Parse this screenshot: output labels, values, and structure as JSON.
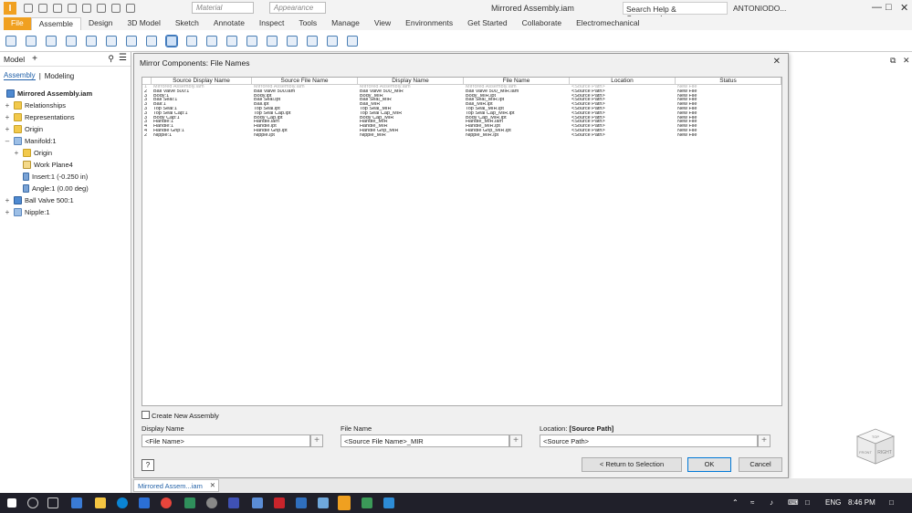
{
  "app": {
    "logo": "I",
    "title": "Mirrored Assembly.iam",
    "material": "Material",
    "appearance": "Appearance",
    "search_help": "Search Help & Commands...",
    "user": "ANTONIODO...",
    "colors": {
      "accent": "#f0a020",
      "link": "#1f5fa8",
      "taskbar": "#20202a"
    }
  },
  "ribbon_tabs": [
    "File",
    "Assemble",
    "Design",
    "3D Model",
    "Sketch",
    "Annotate",
    "Inspect",
    "Tools",
    "Manage",
    "View",
    "Environments",
    "Get Started",
    "Collaborate",
    "Electromechanical"
  ],
  "model_browser": {
    "title": "Model",
    "tabs": [
      "Assembly",
      "Modeling"
    ],
    "root": "Mirrored Assembly.iam",
    "nodes": [
      {
        "label": "Relationships",
        "icon": "folder-icon"
      },
      {
        "label": "Representations",
        "icon": "folder-icon"
      },
      {
        "label": "Origin",
        "icon": "folder-icon"
      },
      {
        "label": "Manifold:1",
        "icon": "part-icon"
      },
      {
        "label": "Origin",
        "icon": "folder-icon"
      },
      {
        "label": "Work Plane4",
        "icon": "workplane-icon"
      },
      {
        "label": "Insert:1 (-0.250 in)",
        "icon": "constraint-icon"
      },
      {
        "label": "Angle:1 (0.00 deg)",
        "icon": "constraint-icon"
      },
      {
        "label": "Ball Valve 500:1",
        "icon": "assembly-icon"
      },
      {
        "label": "Nipple:1",
        "icon": "part-icon"
      }
    ]
  },
  "dialog": {
    "title": "Mirror Components: File Names",
    "columns": [
      "Source Display Name",
      "Source File Name",
      "Display Name",
      "File Name",
      "Location",
      "Status"
    ],
    "rows": [
      {
        "n": "1",
        "src_display": "Mirrored Assembly.iam",
        "src_file": "Mirrored Assembly.iam",
        "display": "Mirrored Assembly.iam",
        "file": "Mirrored Assembly.iam",
        "location": "<Source Path>",
        "status": "New File"
      },
      {
        "n": "2",
        "src_display": "Ball Valve 500:1",
        "src_file": "Ball Valve 500.iam",
        "display": "Ball Valve 500_MIR",
        "file": "Ball Valve 500_MIR.iam",
        "location": "<Source Path>",
        "status": "New File"
      },
      {
        "n": "3",
        "src_display": "Body:1",
        "src_file": "Body.ipt",
        "display": "Body_MIR",
        "file": "Body_MIR.ipt",
        "location": "<Source Path>",
        "status": "New File"
      },
      {
        "n": "3",
        "src_display": "Ball Seal:1",
        "src_file": "Ball Seal.ipt",
        "display": "Ball Seal_MIR",
        "file": "Ball Seal_MIR.ipt",
        "location": "<Source Path>",
        "status": "New File"
      },
      {
        "n": "3",
        "src_display": "Ball:1",
        "src_file": "Ball.ipt",
        "display": "Ball_MIR",
        "file": "Ball_MIR.ipt",
        "location": "<Source Path>",
        "status": "New File"
      },
      {
        "n": "3",
        "src_display": "Top Seal:1",
        "src_file": "Top Seal.ipt",
        "display": "Top Seal_MIR",
        "file": "Top Seal_MIR.ipt",
        "location": "<Source Path>",
        "status": "New File"
      },
      {
        "n": "3",
        "src_display": "Top Seal Cap:1",
        "src_file": "Top Seal Cap.ipt",
        "display": "Top Seal Cap_MIR",
        "file": "Top Seal Cap_MIR.ipt",
        "location": "<Source Path>",
        "status": "New File"
      },
      {
        "n": "3",
        "src_display": "Body Cap:1",
        "src_file": "Body Cap.ipt",
        "display": "Body Cap_MIR",
        "file": "Body Cap_MIR.ipt",
        "location": "<Source Path>",
        "status": "New File"
      },
      {
        "n": "3",
        "src_display": "Handle:1",
        "src_file": "Handle.iam",
        "display": "Handle_MIR",
        "file": "Handle_MIR.iam",
        "location": "<Source Path>",
        "status": "New File"
      },
      {
        "n": "4",
        "src_display": "Handle:1",
        "src_file": "Handle.ipt",
        "display": "Handle_MIR",
        "file": "Handle_MIR.ipt",
        "location": "<Source Path>",
        "status": "New File"
      },
      {
        "n": "4",
        "src_display": "Handle Grip:1",
        "src_file": "Handle Grip.ipt",
        "display": "Handle Grip_MIR",
        "file": "Handle Grip_MIR.ipt",
        "location": "<Source Path>",
        "status": "New File"
      },
      {
        "n": "2",
        "src_display": "Nipple:1",
        "src_file": "Nipple.ipt",
        "display": "Nipple_MIR",
        "file": "Nipple_MIR.ipt",
        "location": "<Source Path>",
        "status": "New File"
      }
    ],
    "create_new_assembly": "Create New Assembly",
    "display_name_label": "Display Name",
    "display_name_value": "<File Name>",
    "file_name_label": "File Name",
    "file_name_value": "<Source File Name>_MIR",
    "location_label": "Location:",
    "location_label_value": "[Source Path]",
    "location_value": "<Source Path>",
    "help": "?",
    "return_button": "< Return to Selection",
    "ok_button": "OK",
    "cancel_button": "Cancel"
  },
  "viewcube": {
    "top": "TOP",
    "front": "FRONT",
    "right": "RIGHT"
  },
  "doc_tab": "Mirrored Assem...iam",
  "taskbar": {
    "lang": "ENG",
    "time": "8:46 PM"
  }
}
